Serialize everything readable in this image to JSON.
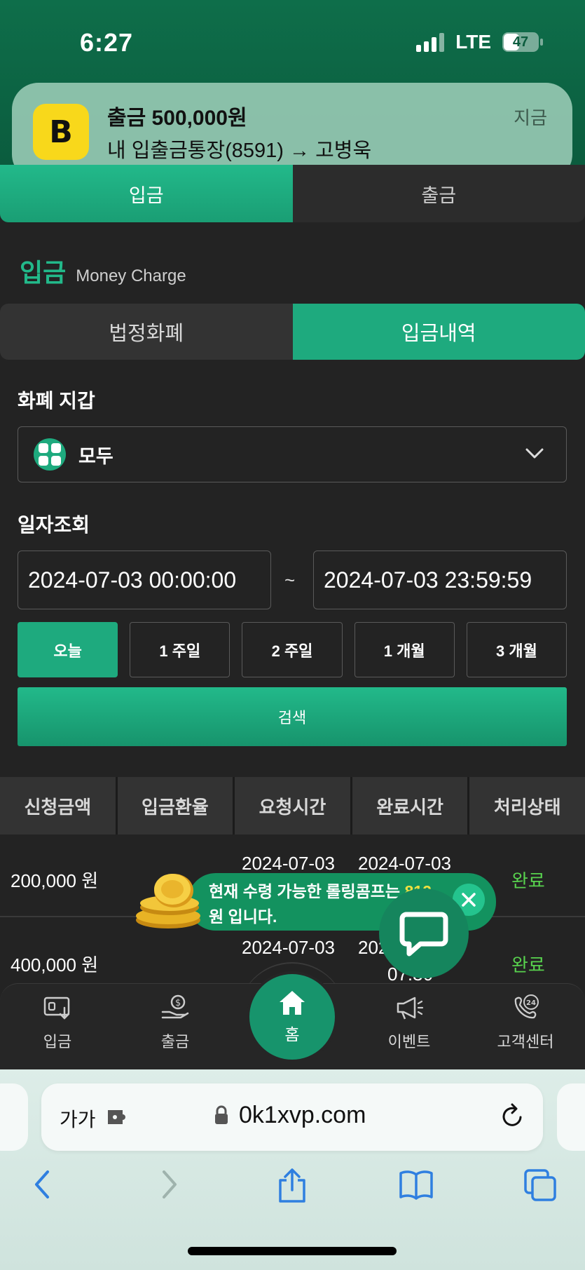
{
  "status_bar": {
    "time": "6:27",
    "network": "LTE",
    "battery": "47"
  },
  "notification": {
    "app_icon_letter": "B",
    "title": "출금 500,000원",
    "body": "내 입출금통장(8591) → 고병욱",
    "time": "지금"
  },
  "main_tabs": [
    "입금",
    "출금"
  ],
  "section": {
    "title": "입금",
    "subtitle": "Money Charge"
  },
  "sub_tabs": [
    "법정화폐",
    "입금내역"
  ],
  "wallet": {
    "label": "화폐 지갑",
    "selected": "모두"
  },
  "date_search": {
    "label": "일자조회",
    "start": "2024-07-03 00:00:00",
    "end": "2024-07-03 23:59:59",
    "separator": "~"
  },
  "periods": [
    "오늘",
    "1 주일",
    "2 주일",
    "1 개월",
    "3 개월"
  ],
  "search_button": "검색",
  "table": {
    "headers": [
      "신청금액",
      "입금환율",
      "요청시간",
      "완료시간",
      "처리상태"
    ],
    "rows": [
      {
        "amount": "200,000 원",
        "request": "2024-07-03",
        "complete": "2024-07-03",
        "status": "완료"
      },
      {
        "amount": "400,000 원",
        "request": "2024-07-03",
        "complete_partial": "202",
        "complete_time_partial": "07:30",
        "status": "완료"
      }
    ]
  },
  "promo": {
    "text_line1": "현재 수령 가능한 롤링콤프는 ",
    "amount": "812",
    "text_line2": "원 입니다."
  },
  "bottom_nav": {
    "deposit": "입금",
    "withdraw": "출금",
    "home": "홈",
    "event": "이벤트",
    "support": "고객센터",
    "support_badge": "24"
  },
  "browser": {
    "text_size": "가가",
    "url": "0k1xvp.com"
  },
  "colors": {
    "accent": "#1eaa7e",
    "header_bg": "#0e6e4a",
    "status_done": "#58d24e"
  }
}
